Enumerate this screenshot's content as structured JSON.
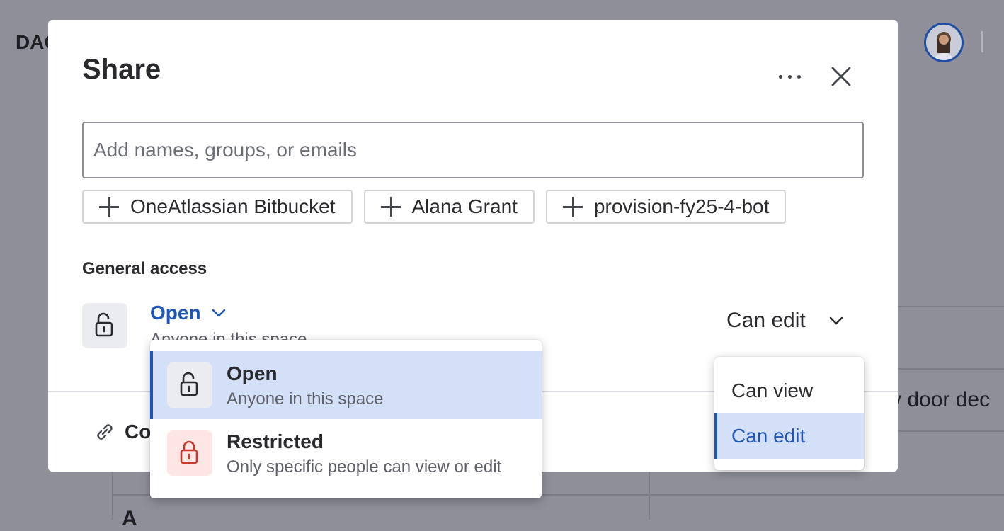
{
  "background": {
    "workspace_label": "DAC",
    "row_text": "y door dec",
    "bottom_text": "A"
  },
  "modal": {
    "title": "Share",
    "more_icon": "more-horizontal-icon",
    "close_icon": "close-icon",
    "search_placeholder": "Add names, groups, or emails",
    "search_value": "",
    "suggestions": [
      {
        "label": "OneAtlassian Bitbucket"
      },
      {
        "label": "Alana Grant"
      },
      {
        "label": "provision-fy25-4-bot"
      }
    ],
    "general_access_label": "General access",
    "access": {
      "selected": "Open",
      "description": "Anyone in this space",
      "permission": "Can edit"
    },
    "copy_link_label": "Co"
  },
  "access_menu": {
    "options": [
      {
        "title": "Open",
        "description": "Anyone in this space",
        "icon": "lock-unlocked-icon",
        "selected": true
      },
      {
        "title": "Restricted",
        "description": "Only specific people can view or edit",
        "icon": "lock-locked-icon",
        "selected": false
      }
    ]
  },
  "permission_menu": {
    "options": [
      {
        "label": "Can view",
        "selected": false
      },
      {
        "label": "Can edit",
        "selected": true
      }
    ]
  },
  "colors": {
    "accent": "#1f56b8",
    "selected_bg": "#d4e0f7",
    "restricted_bg": "#fde6e4",
    "restricted_icon": "#c9372c",
    "overlay": "#8e8f99"
  }
}
